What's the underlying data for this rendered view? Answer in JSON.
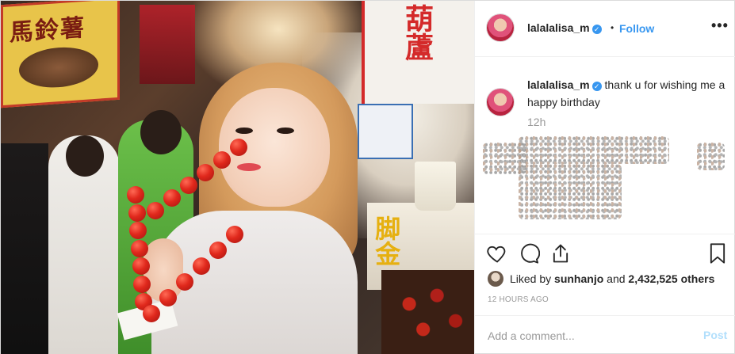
{
  "post": {
    "photo": {
      "sign_left_text": "馬鈴薯",
      "sign_right_text": "葫蘆",
      "stall_text": "脚金"
    },
    "header": {
      "username": "lalalalisa_m",
      "verified_icon": "verified-badge-icon",
      "separator": "•",
      "follow_label": "Follow",
      "more_icon": "more-options-icon"
    },
    "caption": {
      "username": "lalalalisa_m",
      "text": "thank u for wishing me a happy birthday",
      "time": "12h"
    },
    "actions": {
      "like_icon": "heart-icon",
      "comment_icon": "comment-icon",
      "share_icon": "share-icon",
      "save_icon": "bookmark-icon"
    },
    "likes": {
      "prefix": "Liked by",
      "liker": "sunhanjo",
      "joiner": "and",
      "count": "2,432,525 others"
    },
    "timestamp": "12 HOURS AGO",
    "comment": {
      "placeholder": "Add a comment...",
      "post_label": "Post"
    },
    "colors": {
      "accent": "#3897f0",
      "post_disabled": "#b2dffc",
      "muted": "#999999",
      "text": "#262626",
      "border": "#efefef"
    }
  }
}
